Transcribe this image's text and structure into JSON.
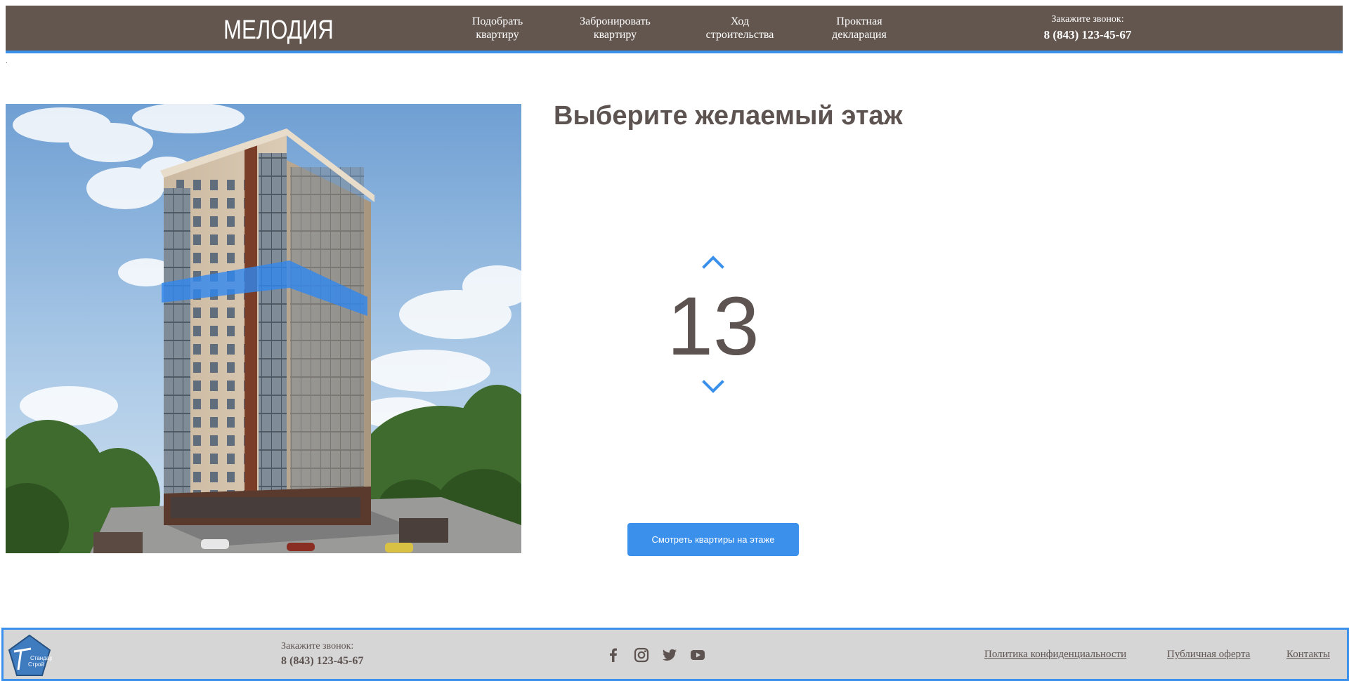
{
  "header": {
    "logo": "МЕЛОДИЯ",
    "nav": [
      {
        "label": "Подобрать\nквартиру"
      },
      {
        "label": "Забронировать\nквартиру"
      },
      {
        "label": "Ход\nстроительства"
      },
      {
        "label": "Проктная\nдекларация"
      }
    ],
    "call_label": "Закажите звонок:",
    "phone": "8 (843) 123-45-67"
  },
  "main": {
    "title": "Выберите желаемый этаж",
    "floor": "13",
    "button_label": "Смотреть квартиры на этаже",
    "up_icon": "chevron-up-icon",
    "down_icon": "chevron-down-icon"
  },
  "footer": {
    "logo_text_1": "Стандарт",
    "logo_text_2": "Строй",
    "call_label": "Закажите звонок:",
    "phone": "8 (843) 123-45-67",
    "social": [
      "facebook-icon",
      "instagram-icon",
      "twitter-icon",
      "youtube-icon"
    ],
    "links": [
      {
        "label": "Политика конфиденциальности "
      },
      {
        "label": "Публичная оферта "
      },
      {
        "label": "Контакты"
      }
    ]
  },
  "colors": {
    "header_bg": "#63564f",
    "accent": "#3a90ea",
    "text": "#5d5350",
    "footer_bg": "#d6d6d6"
  }
}
